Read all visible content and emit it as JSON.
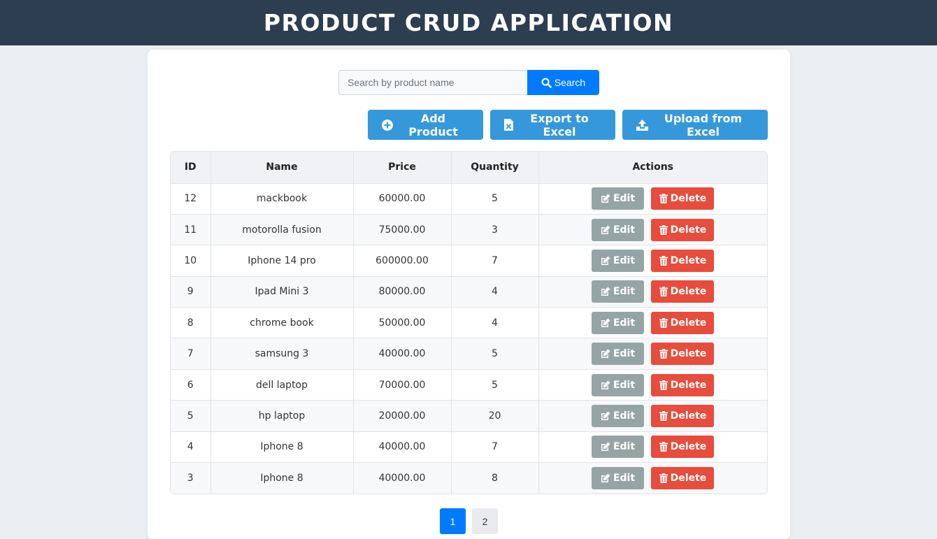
{
  "header": {
    "title": "PRODUCT CRUD APPLICATION"
  },
  "search": {
    "placeholder": "Search by product name",
    "value": "",
    "button_label": "Search"
  },
  "toolbar": {
    "add_label": "Add Product",
    "export_label": "Export to Excel",
    "upload_label": "Upload from Excel"
  },
  "table": {
    "columns": [
      "ID",
      "Name",
      "Price",
      "Quantity",
      "Actions"
    ],
    "rows": [
      {
        "id": "12",
        "name": "mackbook",
        "price": "60000.00",
        "quantity": "5"
      },
      {
        "id": "11",
        "name": "motorolla fusion",
        "price": "75000.00",
        "quantity": "3"
      },
      {
        "id": "10",
        "name": "Iphone 14 pro",
        "price": "600000.00",
        "quantity": "7"
      },
      {
        "id": "9",
        "name": "Ipad Mini 3",
        "price": "80000.00",
        "quantity": "4"
      },
      {
        "id": "8",
        "name": "chrome book",
        "price": "50000.00",
        "quantity": "4"
      },
      {
        "id": "7",
        "name": "samsung 3",
        "price": "40000.00",
        "quantity": "5"
      },
      {
        "id": "6",
        "name": "dell laptop",
        "price": "70000.00",
        "quantity": "5"
      },
      {
        "id": "5",
        "name": "hp laptop",
        "price": "20000.00",
        "quantity": "20"
      },
      {
        "id": "4",
        "name": "Iphone 8",
        "price": "40000.00",
        "quantity": "7"
      },
      {
        "id": "3",
        "name": "Iphone 8",
        "price": "40000.00",
        "quantity": "8"
      }
    ],
    "edit_label": "Edit",
    "delete_label": "Delete"
  },
  "pagination": {
    "pages": [
      "1",
      "2"
    ],
    "current": "1"
  },
  "colors": {
    "header_bg": "#2c3e50",
    "primary": "#007bff",
    "action_blue": "#3498db",
    "edit_gray": "#95a5a6",
    "delete_red": "#e74c3c"
  },
  "icons": {
    "search": "search-icon",
    "add": "plus-circle-icon",
    "export": "file-excel-icon",
    "upload": "upload-icon",
    "edit": "edit-icon",
    "delete": "trash-icon"
  }
}
